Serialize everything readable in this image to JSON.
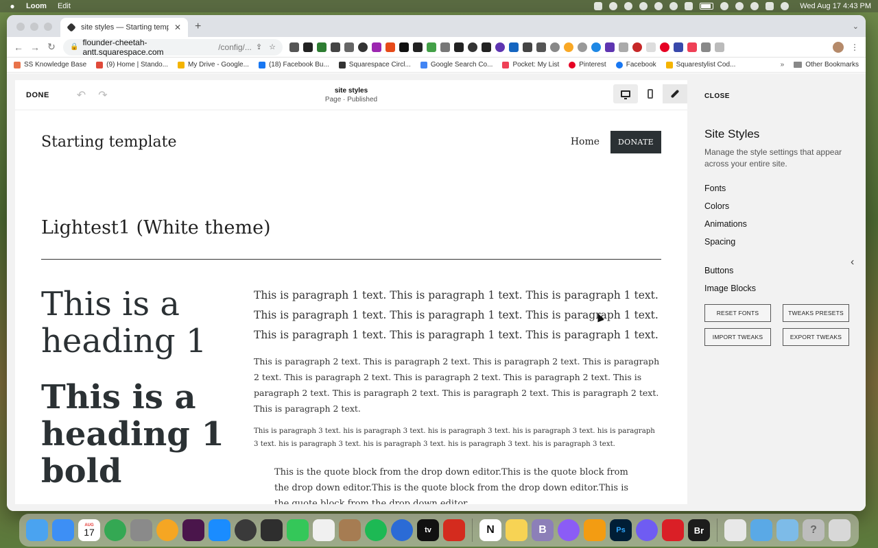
{
  "menubar": {
    "app_name": "Loom",
    "menus": [
      "Edit"
    ],
    "datetime": "Wed Aug 17  4:43 PM"
  },
  "browser": {
    "tab_title": "site styles — Starting template",
    "url_domain": "flounder-cheetah-antt.squarespace.com",
    "url_path": "/config/...",
    "bookmarks": [
      {
        "label": "SS Knowledge Base",
        "color": "#e8734a"
      },
      {
        "label": "(9) Home | Stando...",
        "color": "#e04a3a"
      },
      {
        "label": "My Drive - Google...",
        "color": "#f4b400"
      },
      {
        "label": "(18) Facebook Bu...",
        "color": "#1877f2"
      },
      {
        "label": "Squarespace Circl...",
        "color": "#333333"
      },
      {
        "label": "Google Search Co...",
        "color": "#4285f4"
      },
      {
        "label": "Pocket: My List",
        "color": "#ef4056"
      },
      {
        "label": "Pinterest",
        "color": "#e60023"
      },
      {
        "label": "Facebook",
        "color": "#1877f2"
      },
      {
        "label": "Squarestylist Cod...",
        "color": "#f5b400"
      }
    ],
    "other_bookmarks": "Other Bookmarks",
    "more_bookmarks": "»"
  },
  "editor": {
    "done_label": "DONE",
    "page_name": "site styles",
    "page_status": "Page · Published"
  },
  "site": {
    "title": "Starting template",
    "nav_home": "Home",
    "donate_label": "DONATE",
    "page_heading": "Lightest1 (White theme)",
    "heading1": "This is a heading 1",
    "heading1_bold": "This is a heading 1 bold",
    "paragraph1": "This is paragraph 1 text. This is paragraph 1 text. This is paragraph 1 text. This is paragraph 1 text. This is paragraph 1 text. This is paragraph 1 text. This is paragraph 1 text. This is paragraph 1 text. This is paragraph 1 text.",
    "paragraph2": "This is paragraph 2 text. This is paragraph 2 text. This is paragraph 2 text. This is paragraph 2 text. This is paragraph 2 text. This is paragraph 2 text. This is paragraph 2 text. This is paragraph 2 text. This is paragraph 2 text. This is paragraph 2 text. This is paragraph 2 text. This is paragraph 2 text.",
    "paragraph3": "This is paragraph 3 text. his is paragraph 3 text. his is paragraph 3 text. his is paragraph 3 text. his is paragraph 3 text. his is paragraph 3 text. his is paragraph 3 text. his is paragraph 3 text. his is paragraph 3 text.",
    "quote": "This is the quote block from the drop down editor.This is the quote block from the drop down editor.This is the quote block from the drop down editor.This is the quote block from the drop down editor."
  },
  "panel": {
    "close_label": "CLOSE",
    "title": "Site Styles",
    "description": "Manage the style settings that appear across your entire site.",
    "links_a": [
      "Fonts",
      "Colors",
      "Animations",
      "Spacing"
    ],
    "links_b": [
      "Buttons",
      "Image Blocks"
    ],
    "buttons": [
      "RESET FONTS",
      "TWEAKS PRESETS",
      "IMPORT TWEAKS",
      "EXPORT TWEAKS"
    ]
  },
  "dock": {
    "calendar_month": "AUG",
    "calendar_day": "17",
    "apps": [
      {
        "name": "finder-app",
        "color": "#4aa3f0",
        "label": ""
      },
      {
        "name": "mail-app",
        "color": "#3d8ff5",
        "label": ""
      },
      {
        "name": "calendar-app",
        "color": "#ffffff",
        "label": ""
      },
      {
        "name": "chrome-app",
        "color": "#34a853",
        "label": ""
      },
      {
        "name": "launchpad-app",
        "color": "#8a8a8a",
        "label": ""
      },
      {
        "name": "photos-app",
        "color": "#f5a623",
        "label": ""
      },
      {
        "name": "slack-app",
        "color": "#4a154b",
        "label": ""
      },
      {
        "name": "app-store-app",
        "color": "#1a8cff",
        "label": ""
      },
      {
        "name": "loom-app",
        "color": "#3a3a3a",
        "label": ""
      },
      {
        "name": "printer-app",
        "color": "#2e2e2e",
        "label": ""
      },
      {
        "name": "messages-app",
        "color": "#34c759",
        "label": ""
      },
      {
        "name": "notes-pencil-app",
        "color": "#f0f0f0",
        "label": ""
      },
      {
        "name": "contacts-app",
        "color": "#a67c52",
        "label": ""
      },
      {
        "name": "spotify-app",
        "color": "#1db954",
        "label": ""
      },
      {
        "name": "1password-app",
        "color": "#2b6bd6",
        "label": ""
      },
      {
        "name": "apple-tv-app",
        "color": "#111111",
        "label": "tv"
      },
      {
        "name": "acrobat-app",
        "color": "#d42b1e",
        "label": ""
      },
      {
        "name": "notion-app",
        "color": "#ffffff",
        "label": "N"
      },
      {
        "name": "notes-app",
        "color": "#f7d354",
        "label": ""
      },
      {
        "name": "bbedit-app",
        "color": "#8c7fb8",
        "label": "B"
      },
      {
        "name": "messenger-app",
        "color": "#8b5cf6",
        "label": ""
      },
      {
        "name": "pages-app",
        "color": "#f39c12",
        "label": ""
      },
      {
        "name": "photoshop-app",
        "color": "#001e36",
        "label": "Ps"
      },
      {
        "name": "settings-app",
        "color": "#6f5cf2",
        "label": ""
      },
      {
        "name": "creative-cloud-app",
        "color": "#da1f26",
        "label": ""
      },
      {
        "name": "bridge-app",
        "color": "#1c1c1c",
        "label": "Br"
      }
    ],
    "right_apps": [
      {
        "name": "document-app",
        "color": "#e8e8e8"
      },
      {
        "name": "applications-folder",
        "color": "#5aa9e6"
      },
      {
        "name": "documents-folder",
        "color": "#7dbbe8"
      },
      {
        "name": "help-app",
        "color": "#bdbdbd"
      },
      {
        "name": "trash-app",
        "color": "#d8d8d8"
      }
    ]
  }
}
